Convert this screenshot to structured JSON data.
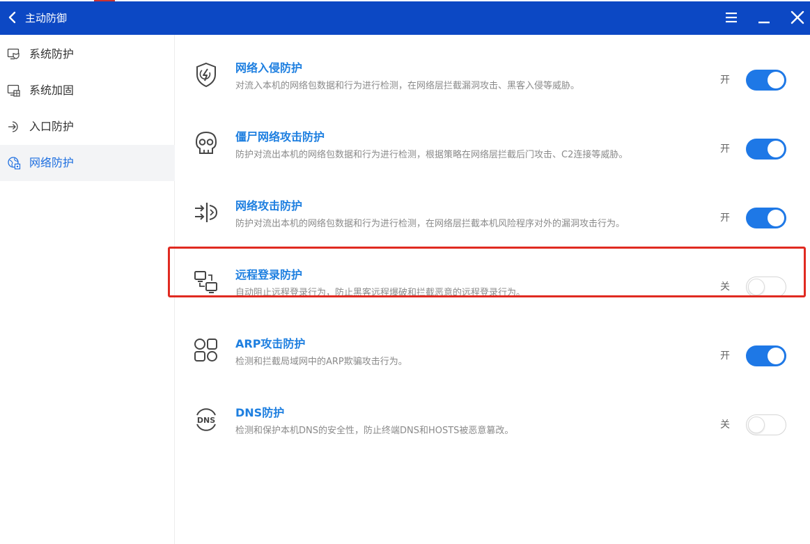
{
  "window": {
    "title": "主动防御",
    "icons": {
      "back": "chevron-left-icon",
      "menu": "menu-icon",
      "minimize": "minimize-icon",
      "close": "close-icon"
    }
  },
  "sidebar": {
    "items": [
      {
        "label": "系统防护",
        "icon": "monitor-shield-icon",
        "active": false
      },
      {
        "label": "系统加固",
        "icon": "monitor-grid-icon",
        "active": false
      },
      {
        "label": "入口防护",
        "icon": "entry-arrow-icon",
        "active": false
      },
      {
        "label": "网络防护",
        "icon": "globe-network-icon",
        "active": true
      }
    ]
  },
  "features": [
    {
      "title": "网络入侵防护",
      "desc": "对流入本机的网络包数据和行为进行检测，在网络层拦截漏洞攻击、黑客入侵等威胁。",
      "state": "开",
      "enabled": true,
      "icon": "shield-lightning-icon"
    },
    {
      "title": "僵尸网络攻击防护",
      "desc": "防护对流出本机的网络包数据和行为进行检测，根据策略在网络层拦截后门攻击、C2连接等威胁。",
      "state": "开",
      "enabled": true,
      "icon": "skull-icon"
    },
    {
      "title": "网络攻击防护",
      "desc": "防护对流出本机的网络包数据和行为进行检测，在网络层拦截本机风险程序对外的漏洞攻击行为。",
      "state": "开",
      "enabled": true,
      "icon": "arrows-shield-icon"
    },
    {
      "title": "远程登录防护",
      "desc": "自动阻止远程登录行为，防止黑客远程爆破和拦截恶意的远程登录行为。",
      "state": "关",
      "enabled": false,
      "icon": "remote-desktop-icon"
    },
    {
      "title": "ARP攻击防护",
      "desc": "检测和拦截局域网中的ARP欺骗攻击行为。",
      "state": "开",
      "enabled": true,
      "icon": "shapes-grid-icon"
    },
    {
      "title": "DNS防护",
      "desc": "检测和保护本机DNS的安全性，防止终端DNS和HOSTS被恶意篡改。",
      "state": "关",
      "enabled": false,
      "icon": "dns-icon"
    }
  ],
  "colors": {
    "titlebar": "#0c48c4",
    "accent": "#1e78e6",
    "title_link": "#1e7fe0",
    "highlight_border": "#e02a21",
    "active_nav_bg": "#f3f4f6"
  }
}
